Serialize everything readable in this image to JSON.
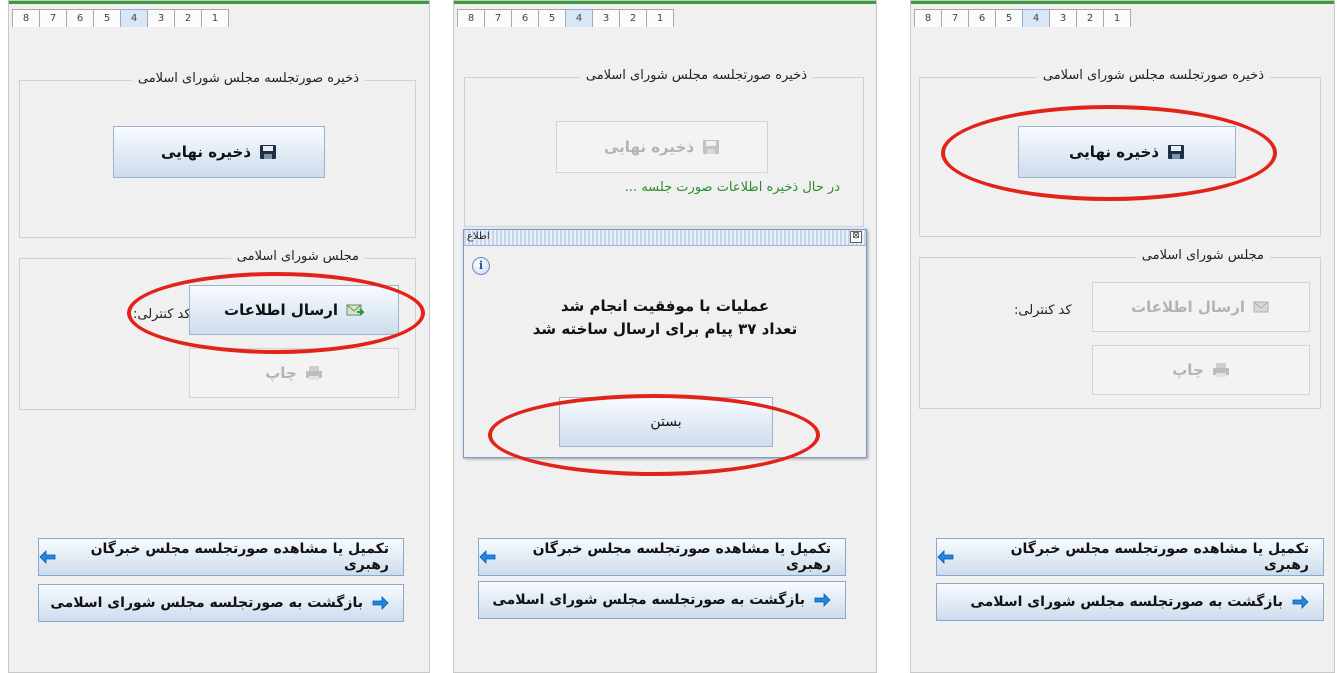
{
  "tabs": [
    "8",
    "7",
    "6",
    "5",
    "4",
    "3",
    "2",
    "1"
  ],
  "group1_title": "ذخیره صورتجلسه مجلس شورای اسلامی",
  "group2_title": "مجلس شورای اسلامی",
  "save_final_label": "ذخیره نهایی",
  "send_info_label": "ارسال اطلاعات",
  "print_label": "چاپ",
  "control_code_label": "کد کنترلی:",
  "status_saving": "در حال ذخیره اطلاعات صورت جلسه ...",
  "nav_complete_label": "تکمیل یا مشاهده صورتجلسه مجلس خبرگان رهبری",
  "nav_back_label": "بازگشت به صورتجلسه  مجلس شورای اسلامی",
  "dialog": {
    "title": "اطلاع",
    "close_glyph": "⊠",
    "info_glyph": "i",
    "line1": "عملیات با موفقیت انجام شد",
    "line2": "تعداد ۳۷ پیام برای ارسال ساخته شد",
    "close_button": "بستن"
  },
  "colors": {
    "highlight_ring": "#e2231a",
    "status_text": "#2e8b2e",
    "active_tab": "#d9e6f5"
  },
  "icons": [
    "save-floppy-icon",
    "send-mail-icon",
    "printer-icon",
    "arrow-left-icon",
    "arrow-right-icon",
    "info-icon"
  ]
}
